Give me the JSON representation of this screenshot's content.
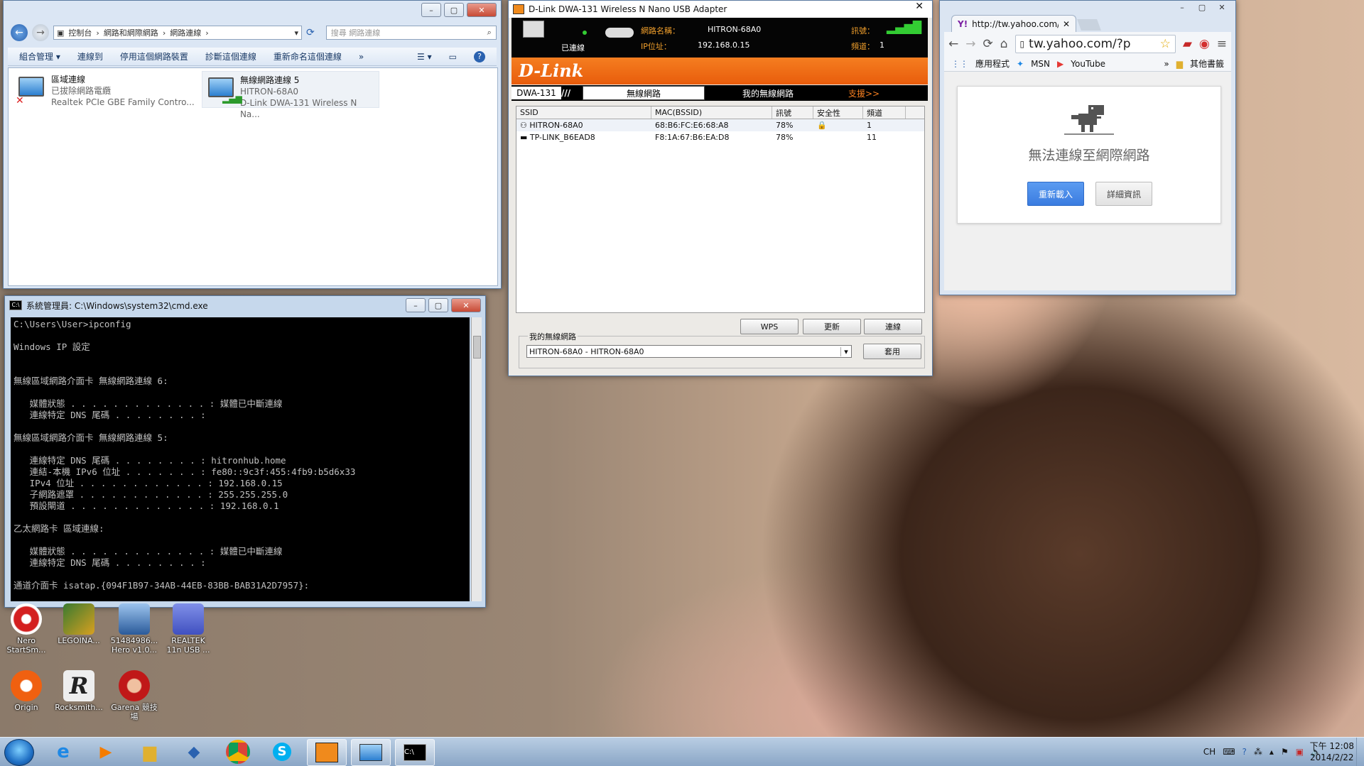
{
  "explorer": {
    "breadcrumb": [
      "控制台",
      "網路和網際網路",
      "網路連線"
    ],
    "search_placeholder": "搜尋 網路連線",
    "toolbar": [
      "組合管理",
      "連線到",
      "停用這個網路裝置",
      "診斷這個連線",
      "重新命名這個連線"
    ],
    "toolbar_more": "»",
    "items": [
      {
        "name": "區域連線",
        "status": "已拔除網路電纜",
        "device": "Realtek PCIe GBE Family Contro..."
      },
      {
        "name": "無線網路連線 5",
        "status": "HITRON-68A0",
        "device": "D-Link DWA-131 Wireless N Na..."
      }
    ]
  },
  "cmd": {
    "title": "系統管理員: C:\\Windows\\system32\\cmd.exe",
    "lines": [
      "C:\\Users\\User>ipconfig",
      "",
      "Windows IP 設定",
      "",
      "",
      "無線區域網路介面卡 無線網路連線 6:",
      "",
      "   媒體狀態 . . . . . . . . . . . . . : 媒體已中斷連線",
      "   連線特定 DNS 尾碼 . . . . . . . . :",
      "",
      "無線區域網路介面卡 無線網路連線 5:",
      "",
      "   連線特定 DNS 尾碼 . . . . . . . . : hitronhub.home",
      "   連結-本機 IPv6 位址 . . . . . . . : fe80::9c3f:455:4fb9:b5d6x33",
      "   IPv4 位址 . . . . . . . . . . . . : 192.168.0.15",
      "   子網路遮罩 . . . . . . . . . . . . : 255.255.255.0",
      "   預設閘道 . . . . . . . . . . . . . : 192.168.0.1",
      "",
      "乙太網路卡 區域連線:",
      "",
      "   媒體狀態 . . . . . . . . . . . . . : 媒體已中斷連線",
      "   連線特定 DNS 尾碼 . . . . . . . . :",
      "",
      "通道介面卡 isatap.{094F1B97-34AB-44EB-83BB-BAB31A2D7957}:"
    ]
  },
  "dlink": {
    "title": "D-Link DWA-131 Wireless N Nano USB Adapter",
    "status_connected": "已連線",
    "network_name_label": "網路名稱：",
    "network_name": "HITRON-68A0",
    "ip_label": "IP位址：",
    "ip": "192.168.0.15",
    "signal_label": "訊號：",
    "channel_label": "頻道：",
    "channel": "1",
    "brand": "D-Link",
    "model": "DWA-131",
    "tabs": [
      "無線網路",
      "我的無線網路",
      "支援>>"
    ],
    "columns": [
      "SSID",
      "MAC(BSSID)",
      "訊號",
      "安全性",
      "頻道"
    ],
    "rows": [
      {
        "ssid": "HITRON-68A0",
        "mac": "68:B6:FC:E6:68:A8",
        "signal": "78%",
        "secure": true,
        "channel": "1"
      },
      {
        "ssid": "TP-LINK_B6EAD8",
        "mac": "F8:1A:67:B6:EA:D8",
        "signal": "78%",
        "secure": false,
        "channel": "11"
      }
    ],
    "buttons": {
      "wps": "WPS",
      "refresh": "更新",
      "connect": "連線",
      "apply": "套用"
    },
    "my_networks_label": "我的無線網路",
    "my_networks_selected": "HITRON-68A0 - HITRON-68A0"
  },
  "chrome": {
    "tab_title": "http://tw.yahoo.com/?p",
    "url": "tw.yahoo.com/?p",
    "bookmarks": [
      "應用程式",
      "MSN",
      "YouTube"
    ],
    "other_bookmarks": "其他書籤",
    "error_title": "無法連線至網際網路",
    "reload": "重新載入",
    "details": "詳細資訊"
  },
  "desktop_icons": [
    {
      "label": "Nero StartSm...",
      "color": "#d42020"
    },
    {
      "label": "LEGOINA...",
      "color": "#3a7a30"
    },
    {
      "label": "51484986... Hero v1.0...",
      "color": "#2a5a9a"
    },
    {
      "label": "REALTEK 11n USB ...",
      "color": "#4050c0"
    },
    {
      "label": "Origin",
      "color": "#f06010"
    },
    {
      "label": "Rocksmith...",
      "color": "#222222"
    },
    {
      "label": "Garena 競技場",
      "color": "#c01818"
    }
  ],
  "tray": {
    "lang": "CH",
    "time": "下午 12:08",
    "date": "2014/2/22"
  }
}
